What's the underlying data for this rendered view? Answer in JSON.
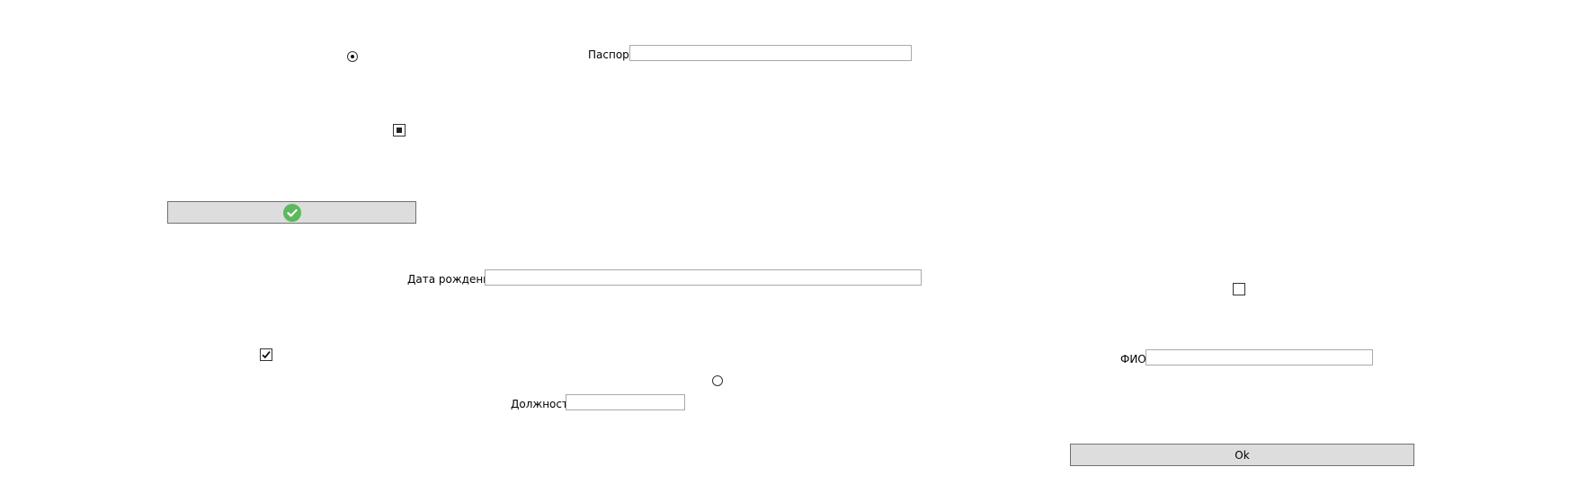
{
  "fields": {
    "passport": {
      "label": "Паспорт",
      "value": ""
    },
    "birth_date": {
      "label": "Дата рождения",
      "value": ""
    },
    "position": {
      "label": "Должность",
      "value": ""
    },
    "full_name": {
      "label": "ФИО",
      "value": ""
    }
  },
  "controls": {
    "radio_top": {
      "checked": true
    },
    "radio_bottom": {
      "checked": false
    },
    "check_indeterminate": {
      "state": "indeterminate"
    },
    "check_checked": {
      "state": "checked"
    },
    "check_empty": {
      "state": "unchecked"
    }
  },
  "buttons": {
    "confirm_icon": "check-circle-icon",
    "confirm_icon_color": "#5cb85c",
    "ok_label": "Ok"
  }
}
